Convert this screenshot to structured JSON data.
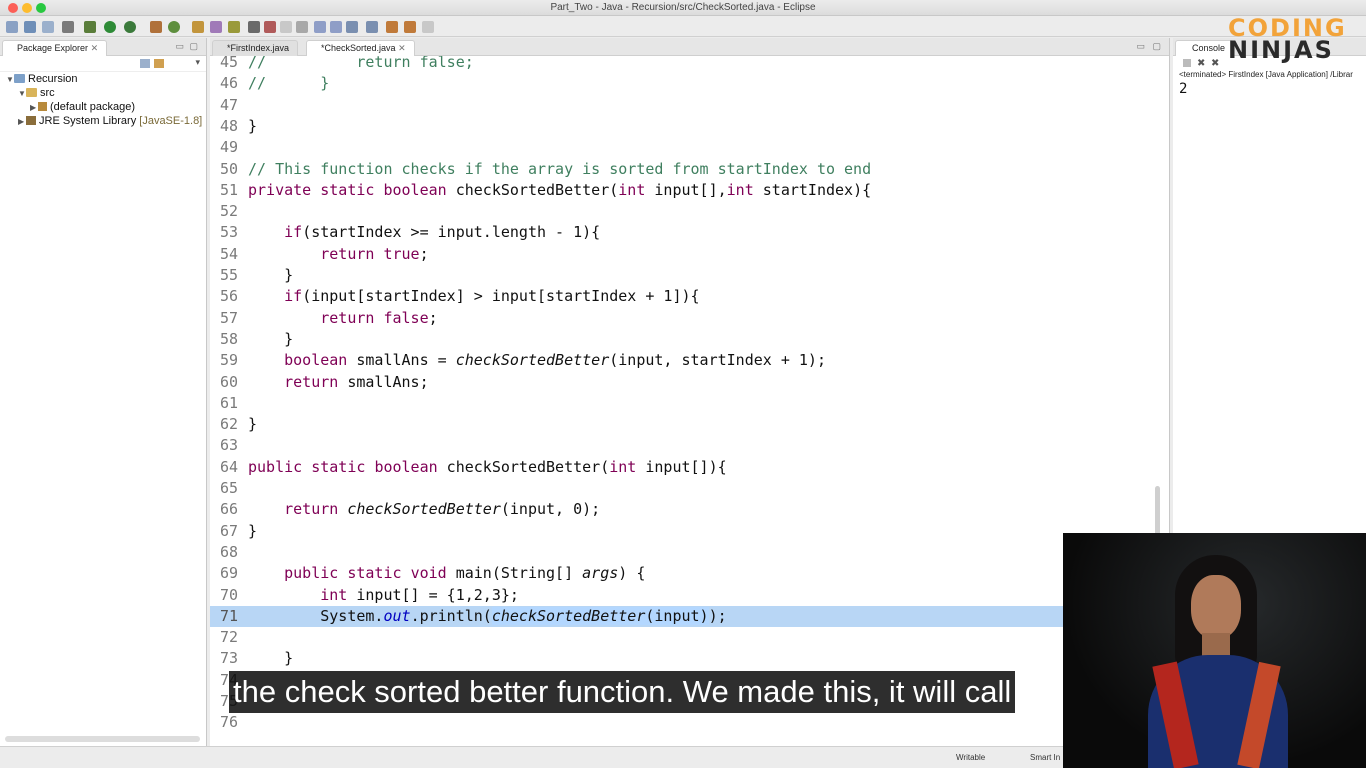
{
  "window": {
    "title": "Part_Two - Java - Recursion/src/CheckSorted.java - Eclipse"
  },
  "package_explorer": {
    "tab_label": "Package Explorer",
    "tree": [
      {
        "label": "Recursion",
        "kind": "project"
      },
      {
        "label": "src",
        "kind": "folder"
      },
      {
        "label": "(default package)",
        "kind": "package"
      },
      {
        "label": "JRE System Library",
        "suffix": "[JavaSE-1.8]",
        "kind": "library"
      }
    ]
  },
  "editor": {
    "tabs": [
      {
        "label": "*FirstIndex.java",
        "active": false
      },
      {
        "label": "*CheckSorted.java",
        "active": true
      }
    ],
    "lines": [
      {
        "n": "45",
        "text": "//          return false;"
      },
      {
        "n": "46",
        "text": "//      }"
      },
      {
        "n": "47",
        "text": ""
      },
      {
        "n": "48",
        "text": "}"
      },
      {
        "n": "49",
        "text": ""
      },
      {
        "n": "50",
        "text": "// This function checks if the array is sorted from startIndex to end"
      },
      {
        "n": "51",
        "text": "private static boolean checkSortedBetter(int input[],int startIndex){"
      },
      {
        "n": "52",
        "text": ""
      },
      {
        "n": "53",
        "text": "    if(startIndex >= input.length - 1){"
      },
      {
        "n": "54",
        "text": "        return true;"
      },
      {
        "n": "55",
        "text": "    }"
      },
      {
        "n": "56",
        "text": "    if(input[startIndex] > input[startIndex + 1]){"
      },
      {
        "n": "57",
        "text": "        return false;"
      },
      {
        "n": "58",
        "text": "    }"
      },
      {
        "n": "59",
        "text": "    boolean smallAns = checkSortedBetter(input, startIndex + 1);"
      },
      {
        "n": "60",
        "text": "    return smallAns;"
      },
      {
        "n": "61",
        "text": ""
      },
      {
        "n": "62",
        "text": "}"
      },
      {
        "n": "63",
        "text": ""
      },
      {
        "n": "64",
        "text": "public static boolean checkSortedBetter(int input[]){"
      },
      {
        "n": "65",
        "text": ""
      },
      {
        "n": "66",
        "text": "    return checkSortedBetter(input, 0);"
      },
      {
        "n": "67",
        "text": "}"
      },
      {
        "n": "68",
        "text": ""
      },
      {
        "n": "69",
        "text": "    public static void main(String[] args) {"
      },
      {
        "n": "70",
        "text": "        int input[] = {1,2,3};"
      },
      {
        "n": "71",
        "text": "        System.out.println(checkSortedBetter(input));"
      },
      {
        "n": "72",
        "text": ""
      },
      {
        "n": "73",
        "text": "    }"
      },
      {
        "n": "74",
        "text": ""
      },
      {
        "n": "75",
        "text": ""
      },
      {
        "n": "76",
        "text": ""
      }
    ]
  },
  "console": {
    "tab_label": "Console",
    "header": "<terminated> FirstIndex [Java Application] /Librar",
    "output": "2"
  },
  "status_bar": {
    "mode": "Writable",
    "insert": "Smart In"
  },
  "subtitle": "the check sorted better function. We made this, it will call",
  "logo": {
    "line1": "CODING",
    "line2": "NINJAS"
  },
  "colors": {
    "keyword": "#7f0055",
    "comment": "#3f7f5f",
    "field": "#0000c0",
    "selection": "#b3d7ff",
    "logo_orange": "#f2a33a"
  }
}
